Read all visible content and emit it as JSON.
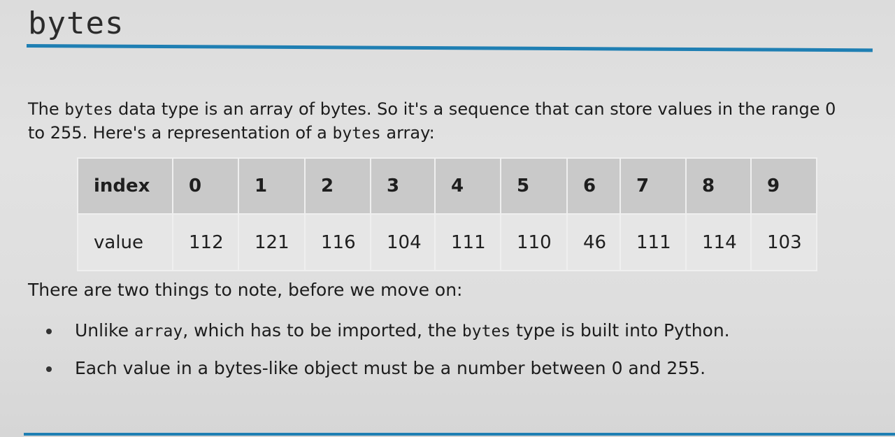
{
  "slide": {
    "title": "bytes",
    "intro": {
      "part1": "The ",
      "code1": "bytes",
      "part2": " data type is an array of bytes. So it's a sequence that can store values in the range 0 to 255. Here's a representation of a ",
      "code2": "bytes",
      "part3": " array:"
    },
    "table": {
      "header_label": "index",
      "value_label": "value",
      "indices": [
        "0",
        "1",
        "2",
        "3",
        "4",
        "5",
        "6",
        "7",
        "8",
        "9"
      ],
      "values": [
        "112",
        "121",
        "116",
        "104",
        "111",
        "110",
        "46",
        "111",
        "114",
        "103"
      ]
    },
    "note": "There are two things to note, before we move on:",
    "bullets": [
      {
        "part1": "Unlike ",
        "code1": "array",
        "part2": ", which has to be imported, the ",
        "code2": "bytes",
        "part3": " type is built into Python."
      },
      {
        "part1": "Each value in a bytes-like object must be a number between 0 and 255."
      }
    ]
  },
  "colors": {
    "accent": "#1f7fb3",
    "header_cell": "#c9c9c9",
    "value_cell": "#e6e6e6"
  }
}
